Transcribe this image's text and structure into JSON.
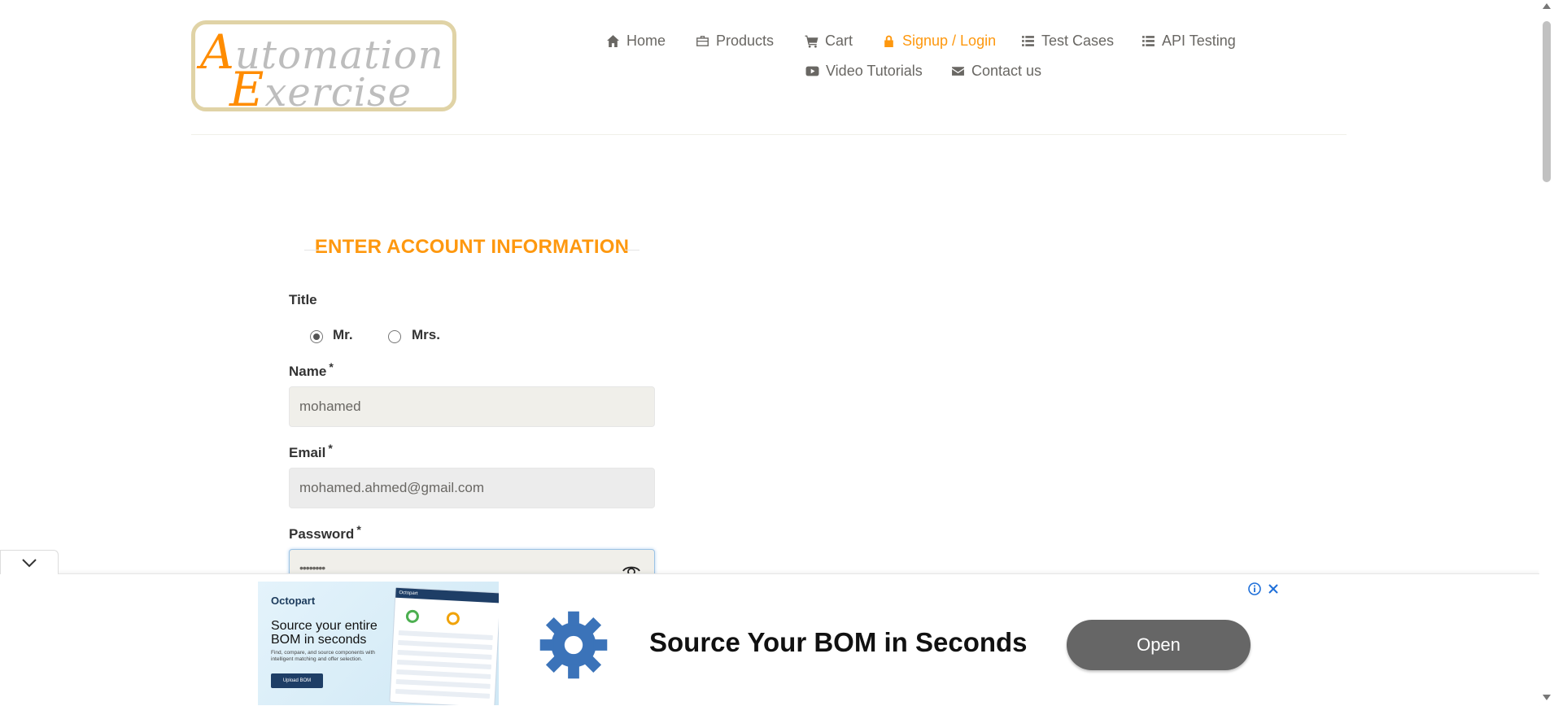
{
  "logo": {
    "line1_cap": "A",
    "line1_rest": "utomation",
    "line2_cap": "E",
    "line2_rest": "xercise"
  },
  "nav": {
    "home": "Home",
    "products": "Products",
    "cart": "Cart",
    "signup": "Signup / Login",
    "test_cases": "Test Cases",
    "api_testing": "API Testing",
    "video_tutorials": "Video Tutorials",
    "contact": "Contact us"
  },
  "form": {
    "heading": "ENTER ACCOUNT INFORMATION",
    "title_label": "Title",
    "title_options": [
      "Mr.",
      "Mrs."
    ],
    "title_selected": "Mr.",
    "name_label": "Name",
    "name_value": "mohamed",
    "email_label": "Email",
    "email_value": "mohamed.ahmed@gmail.com",
    "password_label": "Password",
    "password_value": "••••••••",
    "required_mark": "*"
  },
  "ad": {
    "thumb_brand": "Octopart",
    "thumb_heading": "Source your entire BOM in seconds",
    "thumb_sub": "Find, compare, and source components with intelligent matching and offer selection.",
    "thumb_button": "Upload BOM",
    "thumb_screen_title": "Octopart",
    "headline": "Source Your BOM in Seconds",
    "cta": "Open"
  },
  "colors": {
    "accent": "#fe980f",
    "nav_text": "#696763",
    "ad_button": "#666666",
    "ad_gear": "#3b73b9"
  }
}
